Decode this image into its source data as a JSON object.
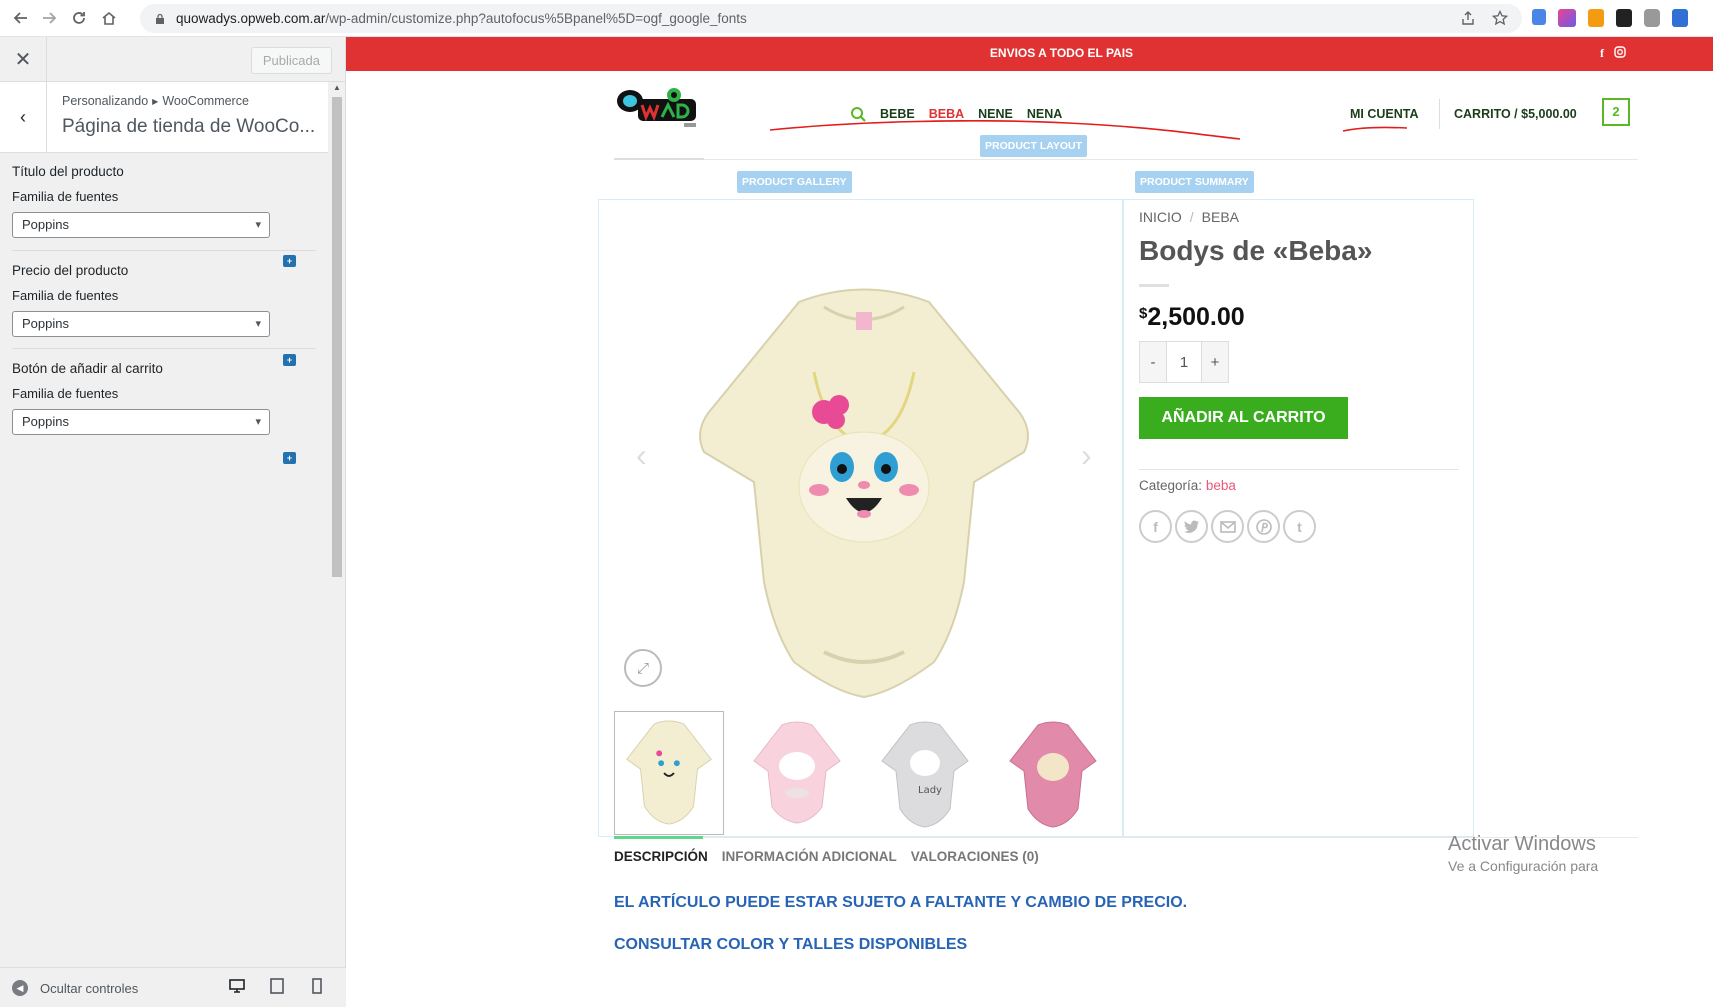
{
  "browser": {
    "url_host": "quowadys.opweb.com.ar",
    "url_path": "/wp-admin/customize.php?autofocus%5Bpanel%5D=ogf_google_fonts"
  },
  "customizer": {
    "publish_label": "Publicada",
    "breadcrumb_1": "Personalizando",
    "breadcrumb_2": "WooCommerce",
    "section_title": "Página de tienda de WooCo...",
    "controls": [
      {
        "title": "Título del producto",
        "sub": "Familia de fuentes",
        "value": "Poppins"
      },
      {
        "title": "Precio del producto",
        "sub": "Familia de fuentes",
        "value": "Poppins"
      },
      {
        "title": "Botón de añadir al carrito",
        "sub": "Familia de fuentes",
        "value": "Poppins"
      }
    ],
    "collapse_label": "Ocultar controles"
  },
  "site": {
    "topbar_text": "ENVIOS A TODO EL PAIS",
    "nav": [
      "BEBE",
      "BEBA",
      "NENE",
      "NENA"
    ],
    "account": "MI CUENTA",
    "cart": "CARRITO / $5,000.00",
    "cart_count": "2",
    "chips": {
      "layout": "PRODUCT LAYOUT",
      "gallery": "PRODUCT GALLERY",
      "summary": "PRODUCT SUMMARY"
    },
    "breadcrumb": [
      "INICIO",
      "BEBA"
    ],
    "product_title": "Bodys de «Beba»",
    "price_symbol": "$",
    "price_value": "2,500.00",
    "qty_minus": "-",
    "qty_value": "1",
    "qty_plus": "+",
    "add_to_cart": "AÑADIR AL CARRITO",
    "category_label": "Categoría:",
    "category_value": "beba",
    "tabs": [
      "DESCRIPCIÓN",
      "INFORMACIÓN ADICIONAL",
      "VALORACIONES (0)"
    ],
    "desc_line_1": "EL ARTÍCULO PUEDE ESTAR SUJETO A FALTANTE Y CAMBIO DE PRECIO.",
    "desc_line_2": "CONSULTAR COLOR Y TALLES DISPONIBLES"
  },
  "watermark": {
    "line1": "Activar Windows",
    "line2": "Ve a Configuración para"
  },
  "colors": {
    "topbar": "#e03232",
    "add_to_cart": "#3aad1e",
    "accent_green": "#59b823",
    "desc_blue": "#2764b5",
    "wp_blue": "#2271b1"
  }
}
